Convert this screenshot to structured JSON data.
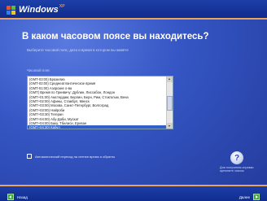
{
  "header": {
    "logo_text": "Windows",
    "logo_sup": "XP"
  },
  "main": {
    "title": "В каком часовом поясе вы находитесь?",
    "subtitle": "Выберите часовой пояс, дата и время в котором вы живёте",
    "list_label": "Часовой пояс",
    "timezones": [
      "(GMT-03:00) Бразилиа",
      "(GMT-02:00) Среднеатлантическое время",
      "(GMT-01:00) Азорские о-ва",
      "(GMT) Время по Гринвичу: Дублин, Лиссабон, Лондон",
      "(GMT+01:00) Амстердам, Берлин, Берн, Рим, Стокгольм, Вена",
      "(GMT+02:00) Афины, Стамбул, Минск",
      "(GMT+03:00) Москва, Санкт-Петербург, Волгоград",
      "(GMT+03:00) Найроби",
      "(GMT+03:30) Тегеран",
      "(GMT+04:00) Абу-Даби, Мускат",
      "(GMT+04:00) Баку, Тбилиси, Ереван",
      "(GMT+04:30) Кабул"
    ],
    "selected_index": 11,
    "dst_label": "Автоматический переход на летнее время и обратно",
    "help_text": "Для получения справки щелкните значок"
  },
  "footer": {
    "back_label": "Назад",
    "next_label": "Далее"
  }
}
